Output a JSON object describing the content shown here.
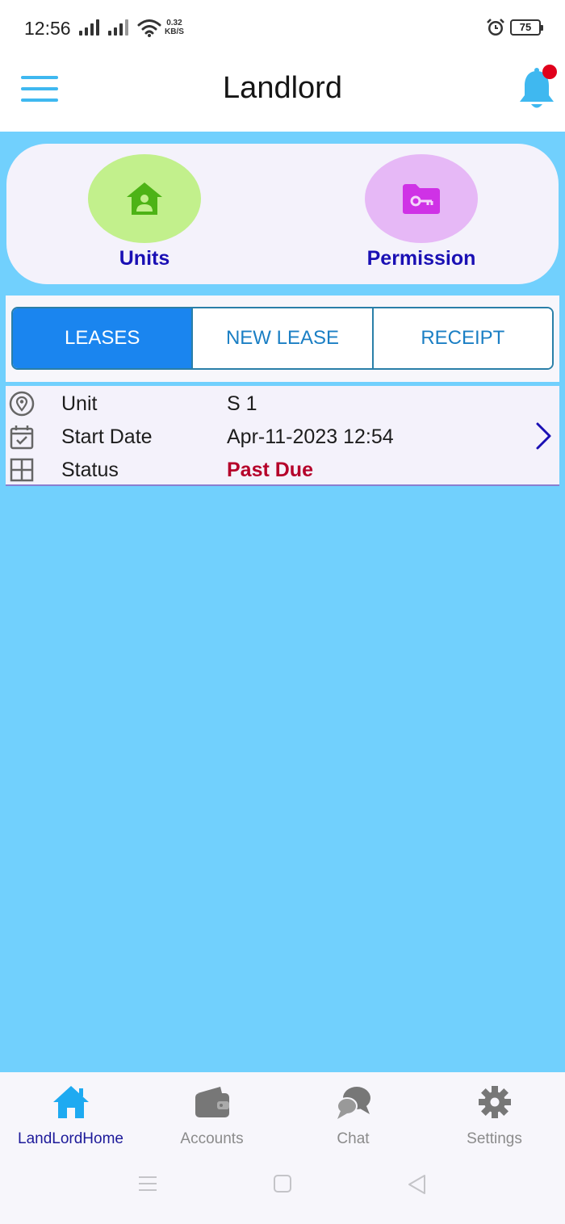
{
  "status_bar": {
    "time": "12:56",
    "net_speed_value": "0.32",
    "net_speed_unit": "KB/S",
    "battery": "75"
  },
  "header": {
    "title": "Landlord",
    "menu_icon": "hamburger-menu-icon",
    "notification_icon": "bell-icon",
    "notification_dot_color": "#e0001b"
  },
  "shortcuts": [
    {
      "label": "Units",
      "icon": "house-person-icon",
      "color": "#c2f08c"
    },
    {
      "label": "Permission",
      "icon": "folder-key-icon",
      "color": "#e6b8f6"
    }
  ],
  "tabs": [
    {
      "label": "LEASES",
      "active": true
    },
    {
      "label": "NEW LEASE",
      "active": false
    },
    {
      "label": "RECEIPT",
      "active": false
    }
  ],
  "lease": {
    "unit_label": "Unit",
    "unit_value": "S 1",
    "start_label": "Start Date",
    "start_value": "Apr-11-2023 12:54",
    "status_label": "Status",
    "status_value": "Past Due",
    "status_color": "#b5002a"
  },
  "bottom_nav": [
    {
      "label": "LandLordHome",
      "icon": "home-icon",
      "active": true
    },
    {
      "label": "Accounts",
      "icon": "wallet-icon",
      "active": false
    },
    {
      "label": "Chat",
      "icon": "chat-icon",
      "active": false
    },
    {
      "label": "Settings",
      "icon": "gear-icon",
      "active": false
    }
  ],
  "colors": {
    "accent": "#1a85ef",
    "background": "#71d0fd",
    "label_blue": "#1a10b4"
  }
}
